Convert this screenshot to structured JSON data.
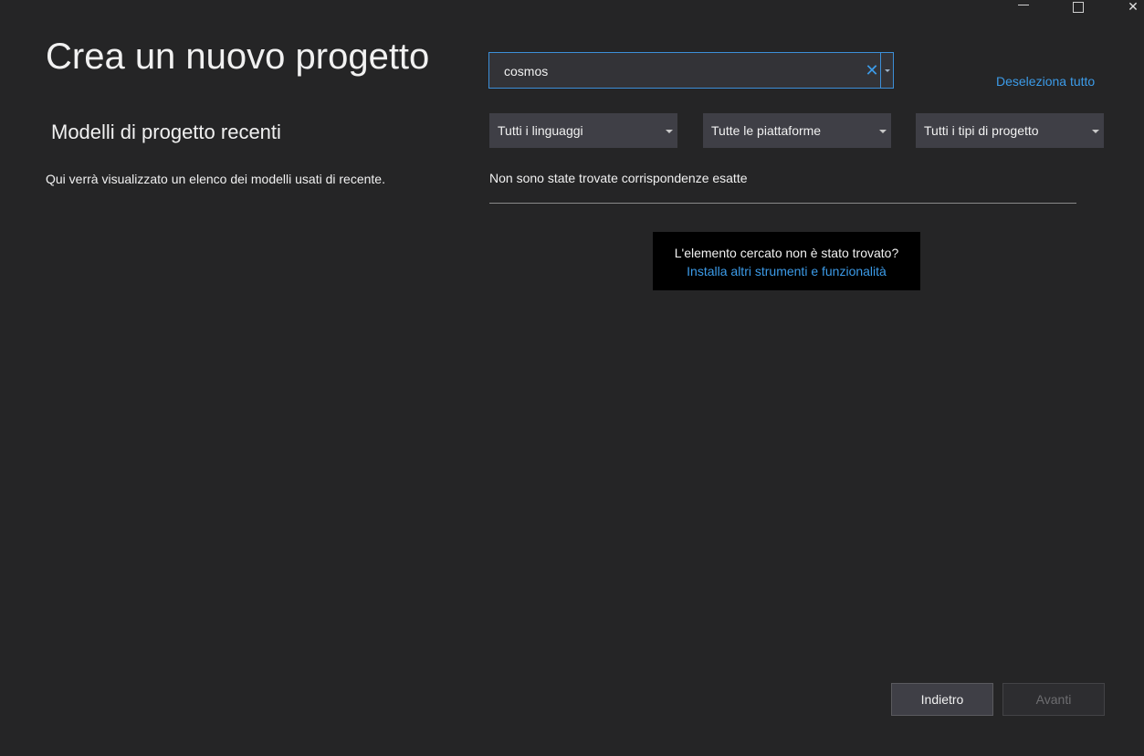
{
  "window_controls": {
    "minimize_icon": "minimize-icon",
    "maximize_icon": "maximize-icon",
    "close_icon": "close-icon",
    "close_glyph": "✕"
  },
  "header": {
    "title": "Crea un nuovo progetto"
  },
  "recent": {
    "heading": "Modelli di progetto recenti",
    "description": "Qui verrà visualizzato un elenco dei modelli usati di recente."
  },
  "search": {
    "value": "cosmos",
    "placeholder": "",
    "clear_glyph": "✕"
  },
  "deselect_label": "Deseleziona tutto",
  "filters": [
    {
      "label": "Tutti i linguaggi"
    },
    {
      "label": "Tutte le piattaforme"
    },
    {
      "label": "Tutti i tipi di progetto"
    }
  ],
  "results": {
    "message": "Non sono state trovate corrispondenze esatte"
  },
  "not_found": {
    "question": "L'elemento cercato non è stato trovato?",
    "install_link": "Installa altri strumenti e funzionalità"
  },
  "footer": {
    "back_label": "Indietro",
    "next_label": "Avanti"
  },
  "colors": {
    "background": "#252526",
    "accent": "#3c9be8",
    "control_bg": "#3f3f46"
  }
}
